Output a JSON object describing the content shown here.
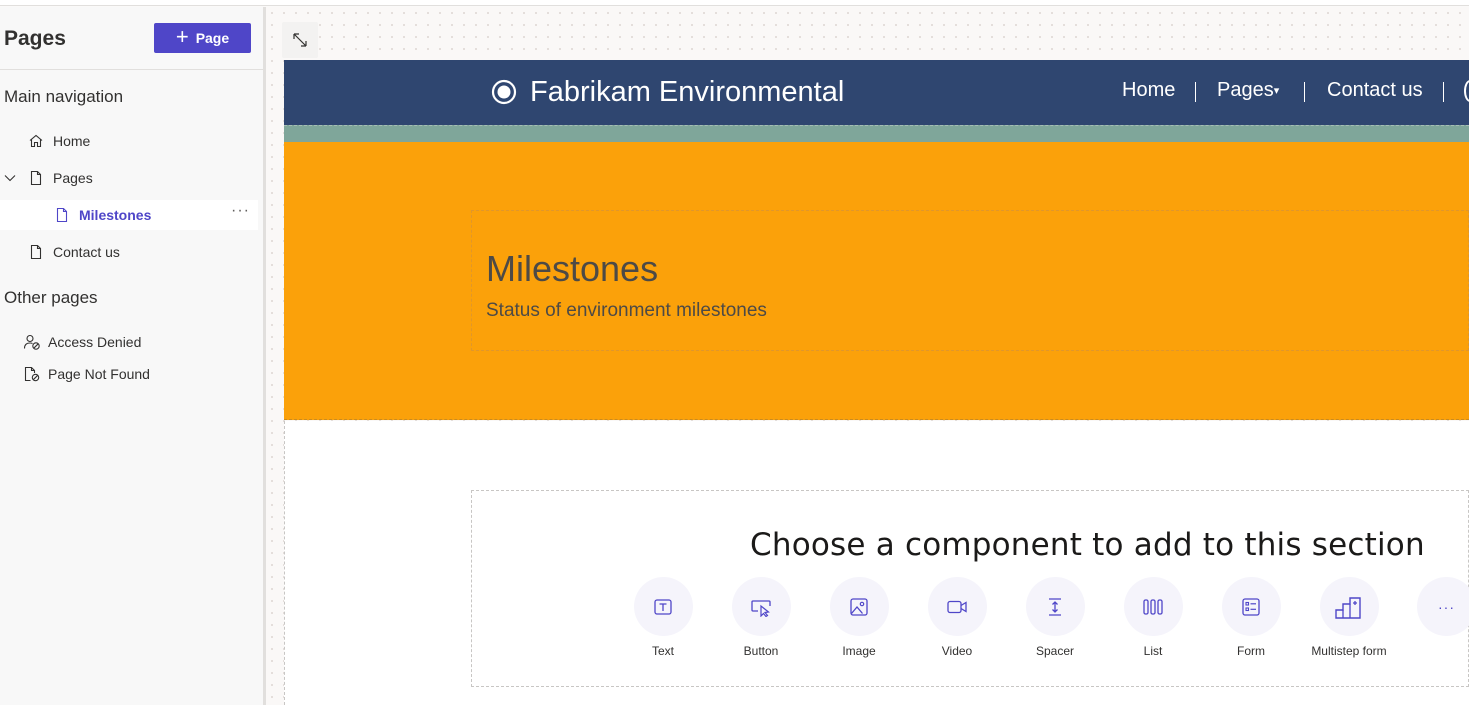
{
  "sidebar": {
    "title": "Pages",
    "add_button_label": "Page",
    "main_nav_title": "Main navigation",
    "main_nav_items": [
      {
        "label": "Home",
        "icon": "home-icon"
      },
      {
        "label": "Pages",
        "icon": "page-icon",
        "expanded": true
      },
      {
        "label": "Milestones",
        "icon": "page-icon",
        "selected": true
      },
      {
        "label": "Contact us",
        "icon": "page-icon"
      }
    ],
    "other_pages_title": "Other pages",
    "other_pages_items": [
      {
        "label": "Access Denied",
        "icon": "access-denied-icon"
      },
      {
        "label": "Page Not Found",
        "icon": "page-not-found-icon"
      }
    ],
    "more_label": "···"
  },
  "site": {
    "title": "Fabrikam Environmental",
    "nav": [
      "Home",
      "Pages",
      "Contact us"
    ],
    "header_color": "#2f4670"
  },
  "hero": {
    "title": "Milestones",
    "subtitle": "Status of environment milestones",
    "color": "#fba10a"
  },
  "components": {
    "prompt": "Choose a component to add to this section",
    "items": [
      {
        "label": "Text",
        "icon": "text-icon"
      },
      {
        "label": "Button",
        "icon": "button-icon"
      },
      {
        "label": "Image",
        "icon": "image-icon"
      },
      {
        "label": "Video",
        "icon": "video-icon"
      },
      {
        "label": "Spacer",
        "icon": "spacer-icon"
      },
      {
        "label": "List",
        "icon": "list-icon"
      },
      {
        "label": "Form",
        "icon": "form-icon"
      },
      {
        "label": "Multistep form",
        "icon": "multistep-form-icon"
      }
    ],
    "more_label": "···"
  },
  "colors": {
    "accent": "#4f46c8",
    "teal": "#7fa69a"
  }
}
